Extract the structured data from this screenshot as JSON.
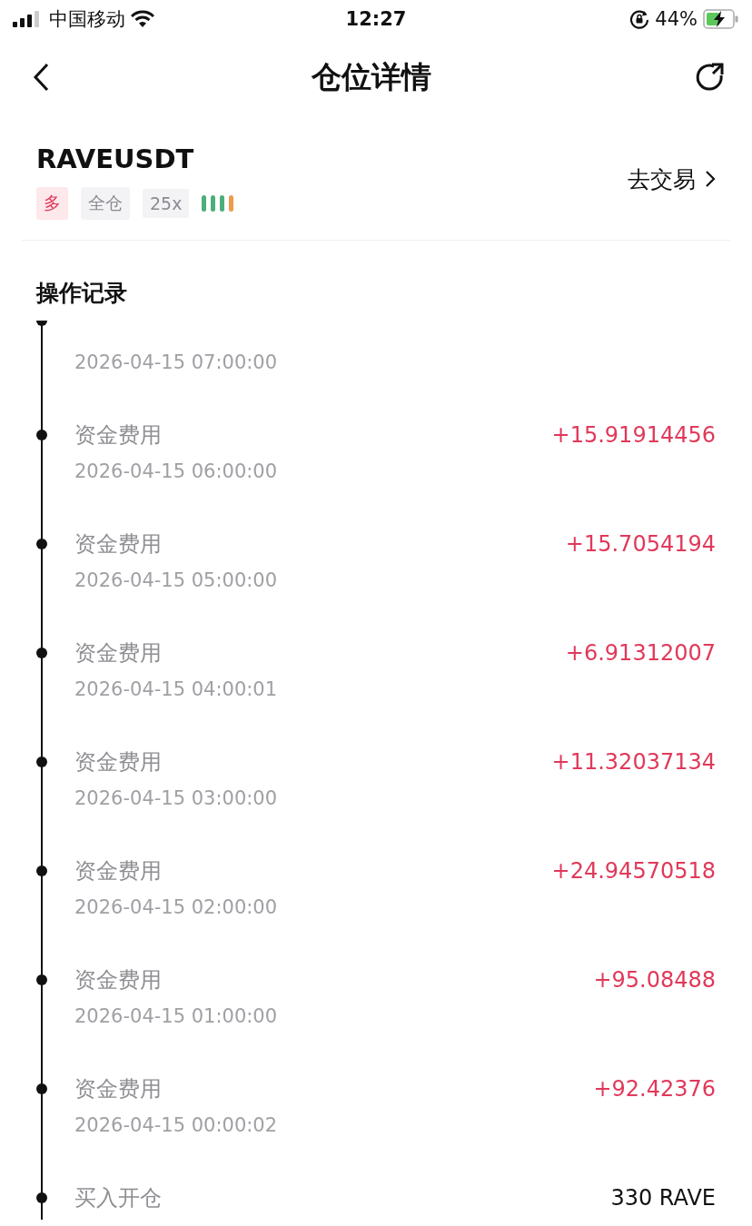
{
  "status_bar": {
    "carrier": "中国移动",
    "time": "12:27",
    "battery": "44%"
  },
  "nav": {
    "title": "仓位详情"
  },
  "position": {
    "symbol": "RAVEUSDT",
    "trade_link": "去交易",
    "tags": [
      {
        "label": "多",
        "kind": "side"
      },
      {
        "label": "全仓",
        "kind": "plain"
      },
      {
        "label": "25x",
        "kind": "plain"
      }
    ],
    "risk_bars": [
      {
        "color": "#4caf7a"
      },
      {
        "color": "#4caf7a"
      },
      {
        "color": "#4caf7a"
      },
      {
        "color": "#ef9a4c"
      }
    ]
  },
  "records": {
    "title": "操作记录",
    "items": [
      {
        "time": "2026-04-15 07:00:00"
      },
      {
        "kind": "funding",
        "label": "资金费用",
        "amount": "+15.91914456",
        "time": "2026-04-15 06:00:00"
      },
      {
        "kind": "funding",
        "label": "资金费用",
        "amount": "+15.7054194",
        "time": "2026-04-15 05:00:00"
      },
      {
        "kind": "funding",
        "label": "资金费用",
        "amount": "+6.91312007",
        "time": "2026-04-15 04:00:01"
      },
      {
        "kind": "funding",
        "label": "资金费用",
        "amount": "+11.32037134",
        "time": "2026-04-15 03:00:00"
      },
      {
        "kind": "funding",
        "label": "资金费用",
        "amount": "+24.94570518",
        "time": "2026-04-15 02:00:00"
      },
      {
        "kind": "funding",
        "label": "资金费用",
        "amount": "+95.08488",
        "time": "2026-04-15 01:00:00"
      },
      {
        "kind": "funding",
        "label": "资金费用",
        "amount": "+92.42376",
        "time": "2026-04-15 00:00:02"
      },
      {
        "kind": "open",
        "label": "买入开仓",
        "amount": "330 RAVE"
      }
    ]
  }
}
